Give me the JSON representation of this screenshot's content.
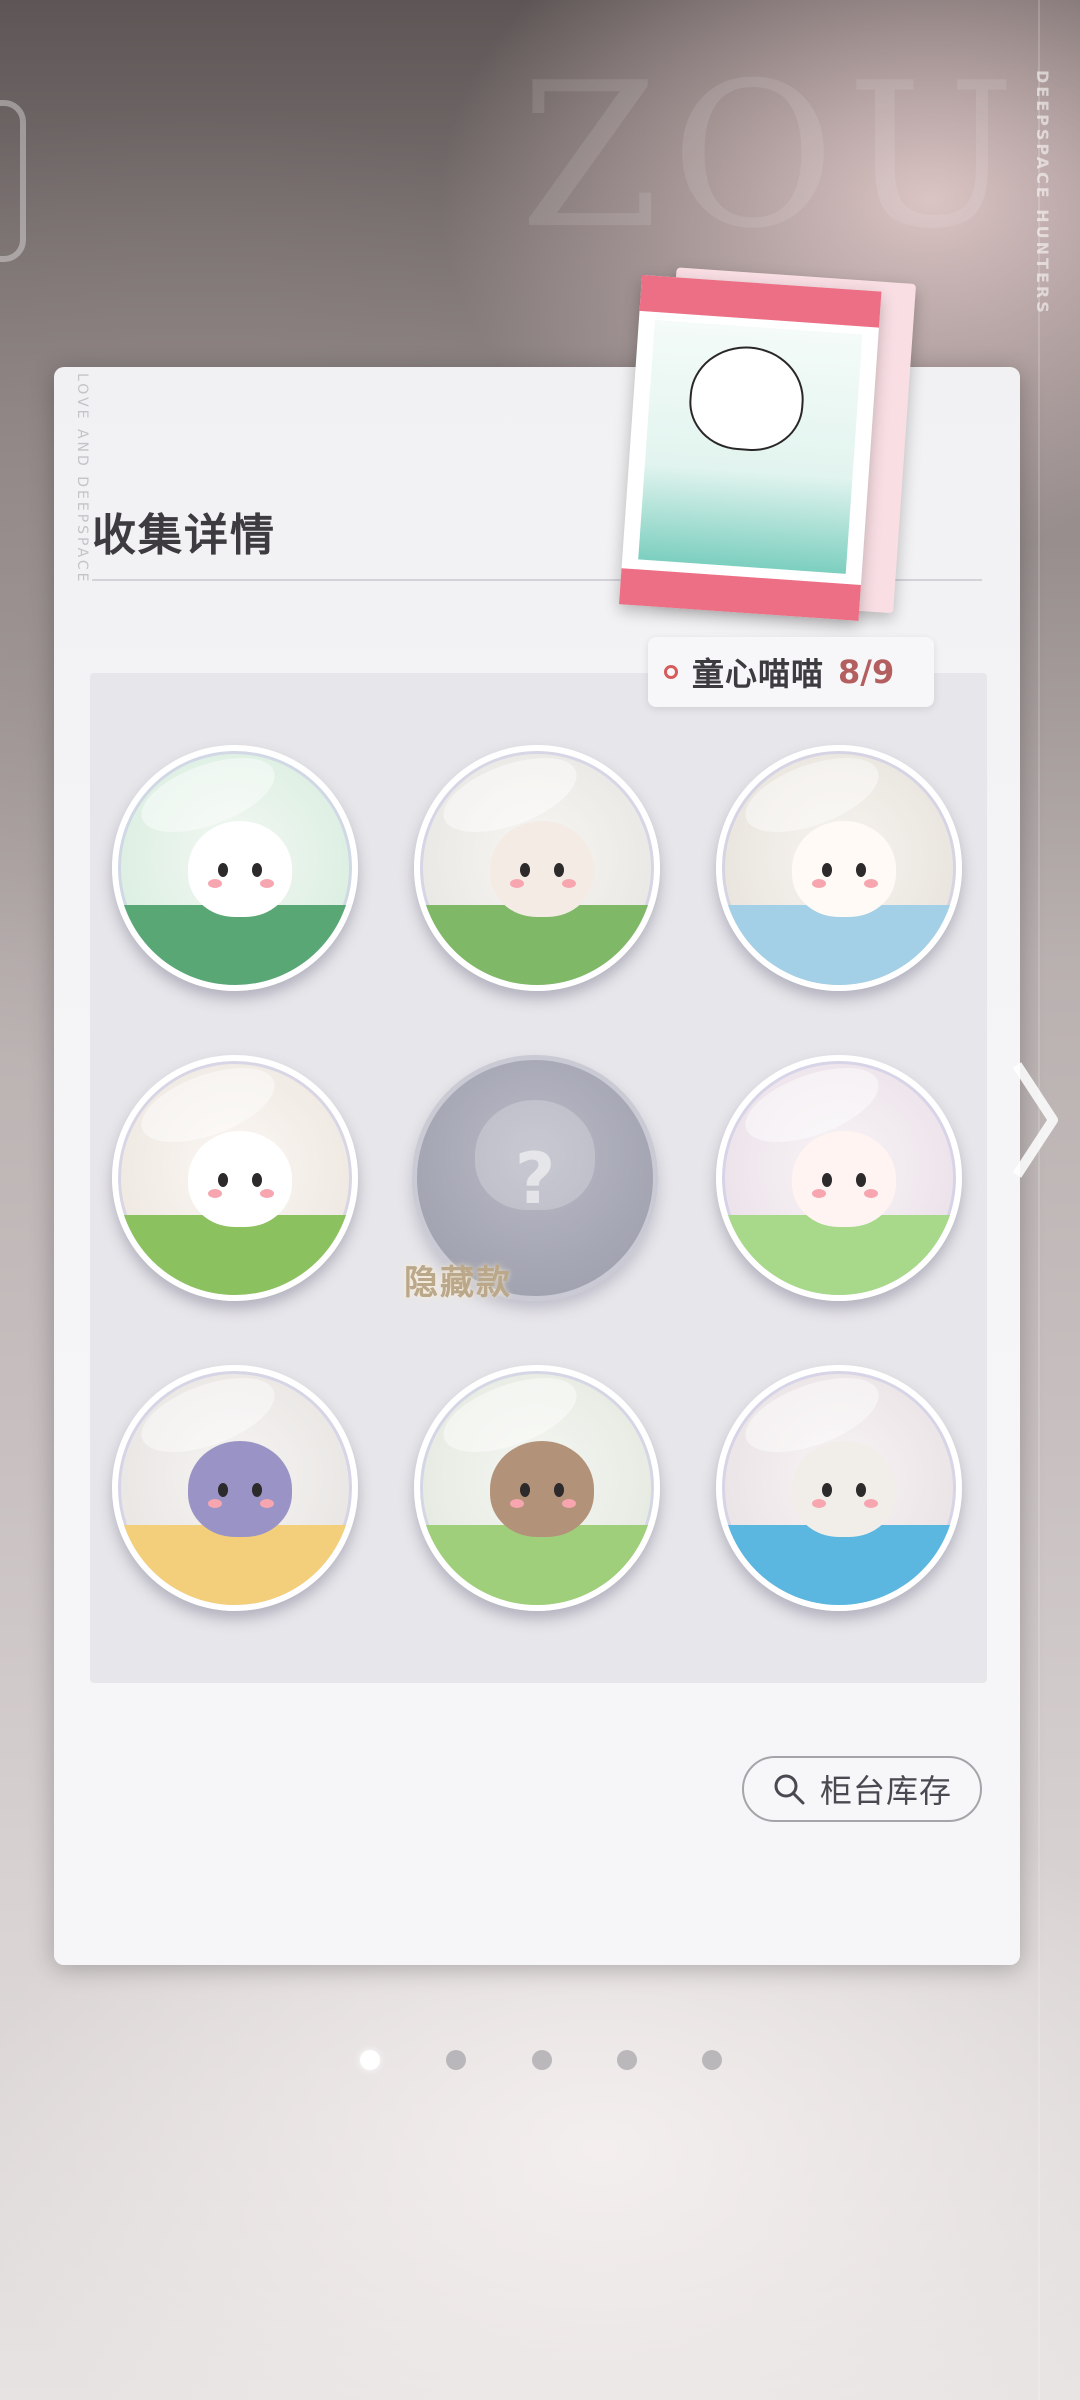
{
  "background": {
    "brand_vertical": "DEEPSPACE HUNTERS"
  },
  "panel": {
    "vertical_text": "LOVE AND DEEPSPACE",
    "title": "收集详情"
  },
  "collection": {
    "name": "童心喵喵",
    "count": "8/9"
  },
  "badges": [
    {
      "state": "collected",
      "theme": "lotus"
    },
    {
      "state": "collected",
      "theme": "butterfly-book"
    },
    {
      "state": "collected",
      "theme": "rocking-horse"
    },
    {
      "state": "collected",
      "theme": "picnic-bear"
    },
    {
      "state": "hidden",
      "label": "隐藏款"
    },
    {
      "state": "collected",
      "theme": "bubbles"
    },
    {
      "state": "collected",
      "theme": "sandcastle"
    },
    {
      "state": "collected",
      "theme": "snake-hat"
    },
    {
      "state": "collected",
      "theme": "number-blocks"
    }
  ],
  "hidden_label": "隐藏款",
  "search_button": {
    "label": "柜台库存",
    "icon": "search-icon"
  },
  "pagination": {
    "total": 5,
    "active": 1
  },
  "colors": {
    "accent_red": "#b45f5f",
    "panel_bg": "#f5f5f7",
    "grid_bg": "#e7e6ea"
  }
}
